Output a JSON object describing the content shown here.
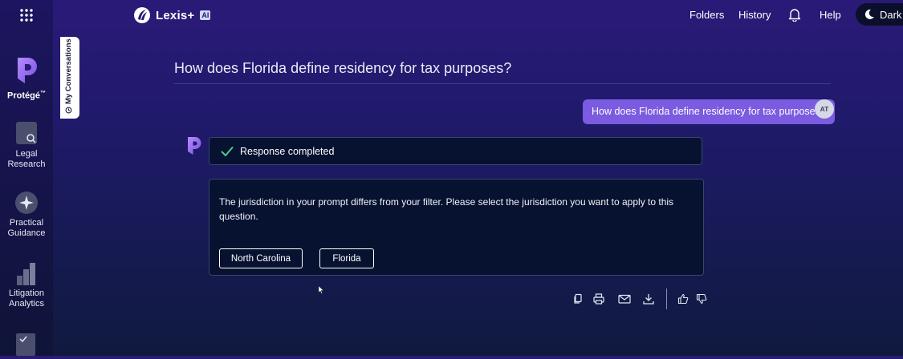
{
  "rail": {
    "protege_label": "Protégé",
    "protege_tm": "™",
    "legal_line1": "Legal",
    "legal_line2": "Research",
    "practical_line1": "Practical",
    "practical_line2": "Guidance",
    "litigation_line1": "Litigation",
    "litigation_line2": "Analytics"
  },
  "conversations_tab": "My Conversations",
  "brand": {
    "name": "Lexis+",
    "ai": "AI"
  },
  "nav": {
    "folders": "Folders",
    "history": "History",
    "help": "Help",
    "theme": "Dark"
  },
  "question_title": "How does Florida define residency for tax purposes?",
  "user_message": "How does Florida define residency for tax purposes?",
  "avatar_initials": "AT",
  "response": {
    "status": "Response completed",
    "message": "The jurisdiction in your prompt differs from your filter. Please select the jurisdiction you want to apply to this question.",
    "options": [
      "North Carolina",
      "Florida"
    ]
  },
  "colors": {
    "accent_purple": "#7b5be0",
    "panel": "#061230",
    "check_green": "#4fc98a"
  },
  "icons": [
    "apps-grid-icon",
    "protege-icon",
    "legal-research-icon",
    "practical-guidance-icon",
    "litigation-analytics-icon",
    "bell-icon",
    "moon-icon",
    "copy-icon",
    "print-icon",
    "email-icon",
    "download-icon",
    "thumbs-up-icon",
    "thumbs-down-icon"
  ]
}
